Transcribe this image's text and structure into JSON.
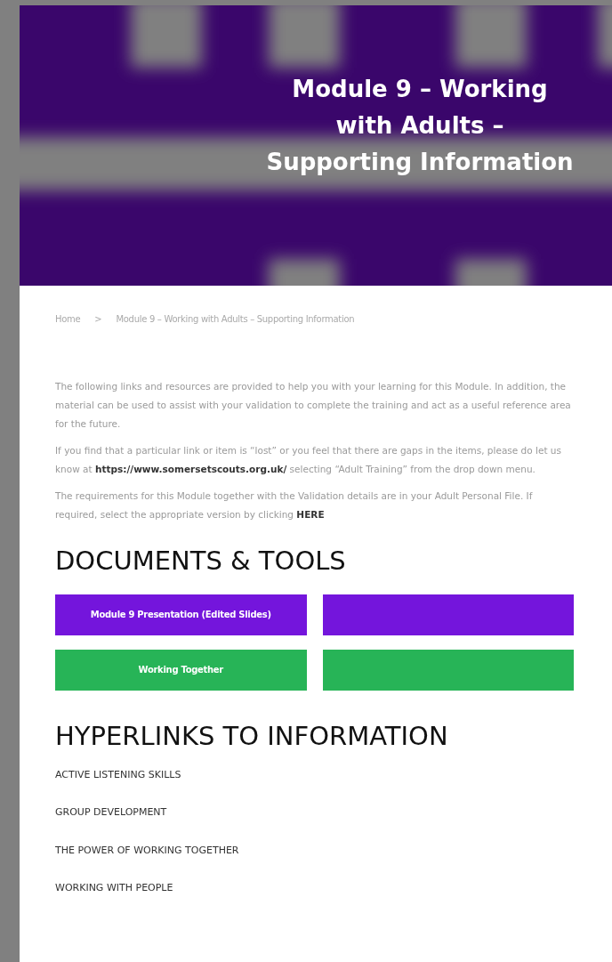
{
  "hero": {
    "kind": "picture",
    "title": "Module 9 – Working with Adults – Supporting Information"
  },
  "breadcrumb": [
    {
      "label": "Home"
    },
    {
      "label": ">"
    },
    {
      "label": "Module 9 – Working with Adults – Supporting Information"
    }
  ],
  "paragraphs": [
    "The following links and resources are provided to help you with your learning for this Module. In addition, the material can be used to assist with your validation to complete the training and act as a useful reference area for the future.",
    "If you find that a particular link or item is “lost” or you feel that there are gaps in the items, please do let us know at **https://www.somersetscouts.org.uk/** selecting “Adult Training” from the drop down menu.",
    "The requirements for this Module together with the Validation details are in your Adult Personal File. If required, select the appropriate version by clicking **HERE**"
  ],
  "documents": {
    "heading": "DOCUMENTS & TOOLS",
    "buttons": [
      {
        "label": "Module 9 Presentation (Edited Slides)",
        "color": "#7415dc"
      },
      {
        "color": "#7415dc"
      },
      {
        "label": "Working Together",
        "color": "#27b457"
      },
      {
        "color": "#27b457"
      }
    ]
  },
  "hyperlinks": {
    "heading": "HYPERLINKS TO INFORMATION",
    "items": [
      "ACTIVE LISTENING SKILLS",
      "GROUP DEVELOPMENT",
      "THE POWER OF WORKING TOGETHER",
      "WORKING WITH PEOPLE"
    ]
  }
}
